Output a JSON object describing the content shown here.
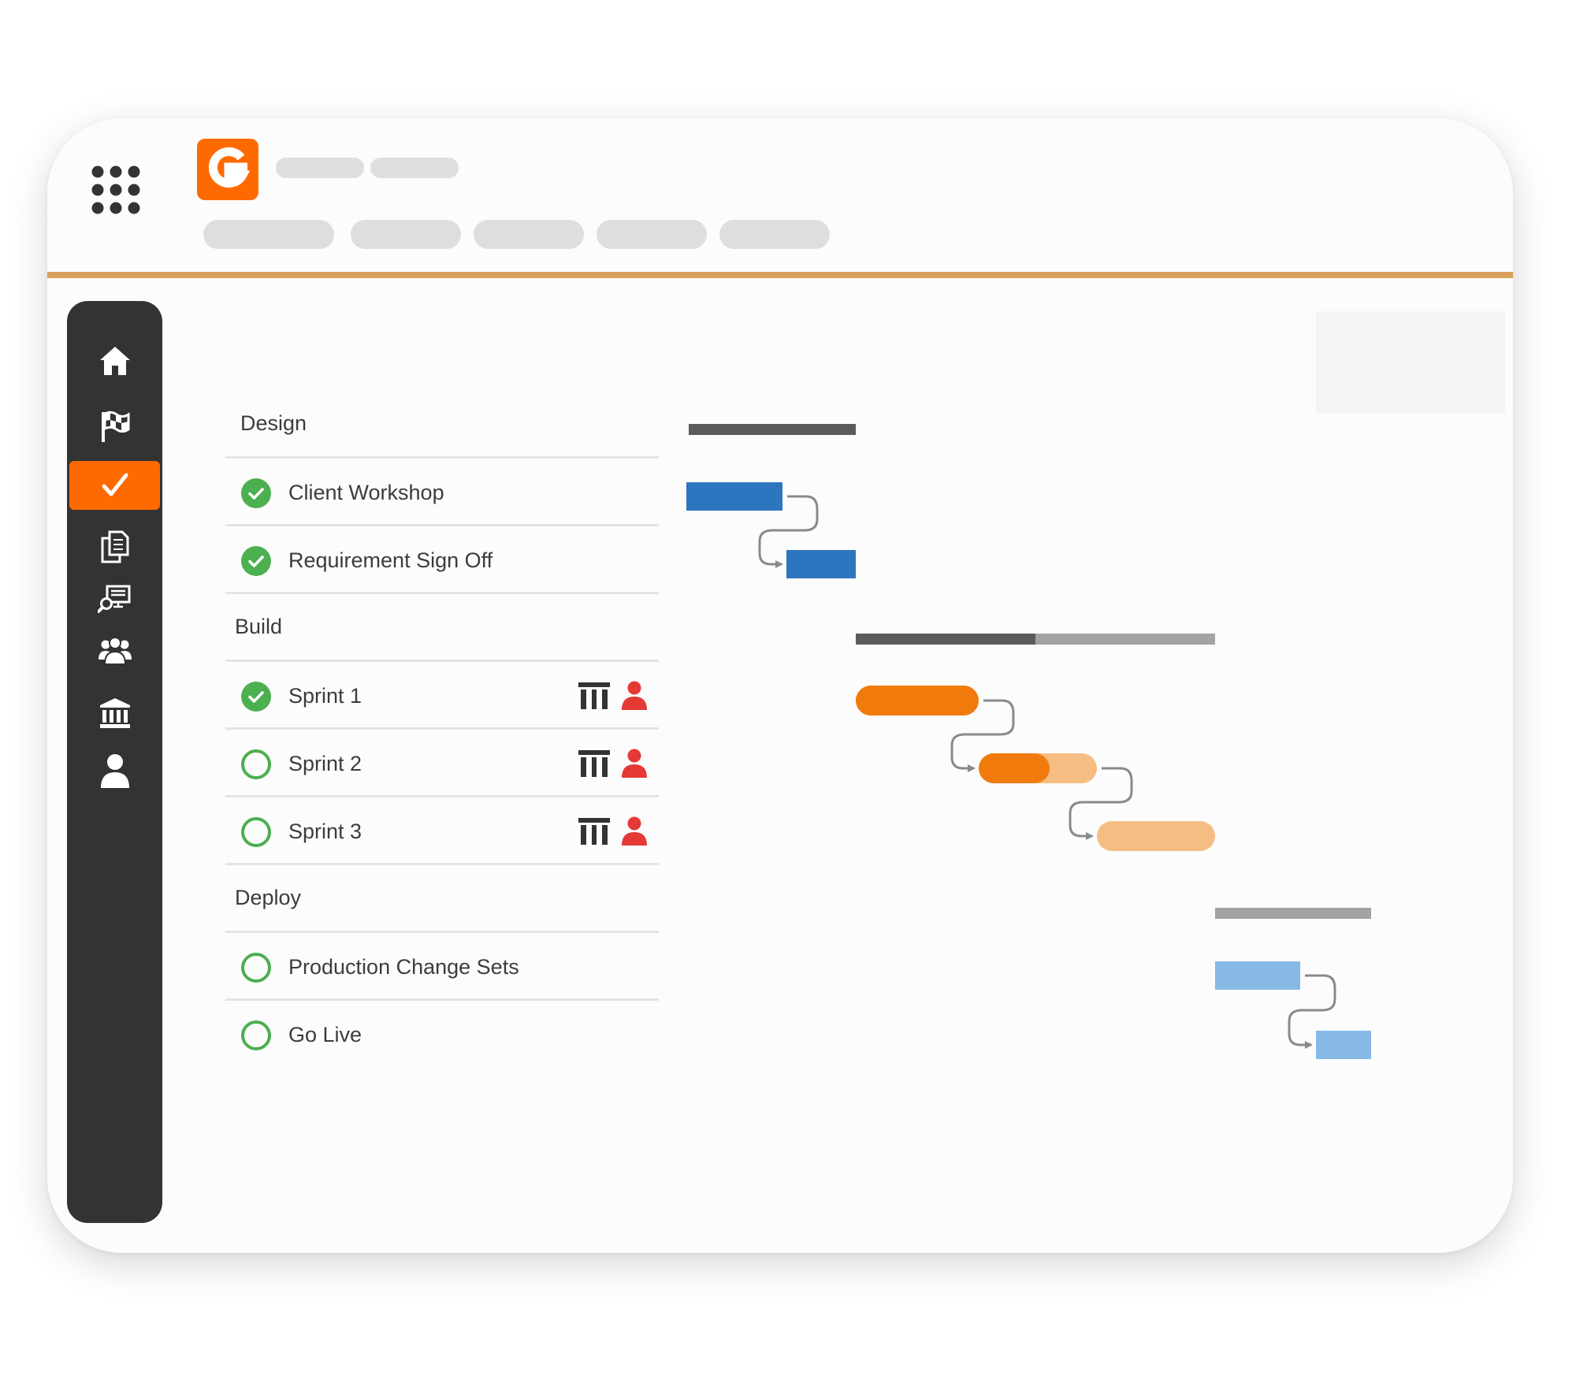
{
  "colors": {
    "accent": "#ff6a00",
    "divider": "#d9a05b",
    "sidebar_bg": "#333333",
    "done_green": "#4caf50",
    "assignee_red": "#e53935",
    "design_bar": "#2e75c0",
    "build_bar": "#f07b0c",
    "build_bar_light": "#f6bd83",
    "deploy_bar": "#87b9e6",
    "summary_dark": "#5b5b5b",
    "summary_light": "#a3a3a3",
    "connector": "#8a8a8a"
  },
  "header": {
    "logo_letter": "G",
    "logo_icon": "brand-g-icon",
    "apps_icon": "apps-grid-icon"
  },
  "sidebar": {
    "items": [
      {
        "icon": "home-icon",
        "active": false
      },
      {
        "icon": "flag-icon",
        "active": false
      },
      {
        "icon": "check-icon",
        "active": true
      },
      {
        "icon": "documents-icon",
        "active": false
      },
      {
        "icon": "report-search-icon",
        "active": false
      },
      {
        "icon": "team-icon",
        "active": false
      },
      {
        "icon": "bank-icon",
        "active": false
      },
      {
        "icon": "user-icon",
        "active": false
      }
    ]
  },
  "tasks": {
    "groups": [
      {
        "name": "Design",
        "items": [
          {
            "name": "Client Workshop",
            "done": true
          },
          {
            "name": "Requirement Sign Off",
            "done": true
          }
        ]
      },
      {
        "name": "Build",
        "items": [
          {
            "name": "Sprint 1",
            "done": true,
            "board_icon": "board-icon",
            "assignee_icon": "assignee-icon"
          },
          {
            "name": "Sprint 2",
            "done": false,
            "board_icon": "board-icon",
            "assignee_icon": "assignee-icon"
          },
          {
            "name": "Sprint 3",
            "done": false,
            "board_icon": "board-icon",
            "assignee_icon": "assignee-icon"
          }
        ]
      },
      {
        "name": "Deploy",
        "items": [
          {
            "name": "Production Change Sets",
            "done": false
          },
          {
            "name": "Go Live",
            "done": false
          }
        ]
      }
    ]
  },
  "gantt": {
    "summaries": [
      {
        "group": "Design",
        "progress": 1.0
      },
      {
        "group": "Build",
        "progress": 0.5
      },
      {
        "group": "Deploy",
        "progress": 0.0
      }
    ],
    "task_bars": [
      {
        "task": "Client Workshop",
        "progress": 1.0
      },
      {
        "task": "Requirement Sign Off",
        "progress": 1.0
      },
      {
        "task": "Sprint 1",
        "progress": 1.0
      },
      {
        "task": "Sprint 2",
        "progress": 0.6
      },
      {
        "task": "Sprint 3",
        "progress": 0.0
      },
      {
        "task": "Production Change Sets",
        "progress": 0.0
      },
      {
        "task": "Go Live",
        "progress": 0.0
      }
    ]
  }
}
